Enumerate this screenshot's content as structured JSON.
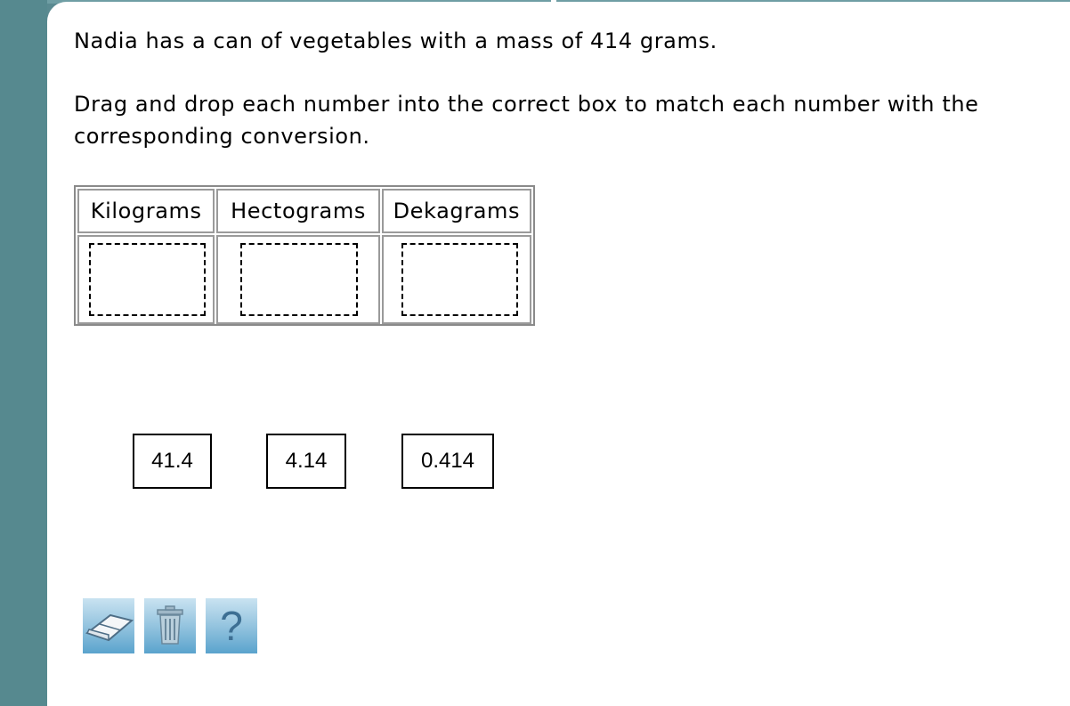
{
  "question": {
    "line1": "Nadia has a can of vegetables with a mass of 414 grams.",
    "line2": "Drag and drop each number into the correct box to match each number with the",
    "line3": "corresponding conversion."
  },
  "table": {
    "headers": [
      "Kilograms",
      "Hectograms",
      "Dekagrams"
    ]
  },
  "tiles": [
    "41.4",
    "4.14",
    "0.414"
  ],
  "toolbar": {
    "eraser_icon": "eraser-icon",
    "trash_icon": "trash-icon",
    "help_icon": "help-icon",
    "help_glyph": "?"
  },
  "colors": {
    "rail": "#56898f",
    "tool_gradient_top": "#c9e3f1",
    "tool_gradient_bottom": "#5aa3cd"
  }
}
